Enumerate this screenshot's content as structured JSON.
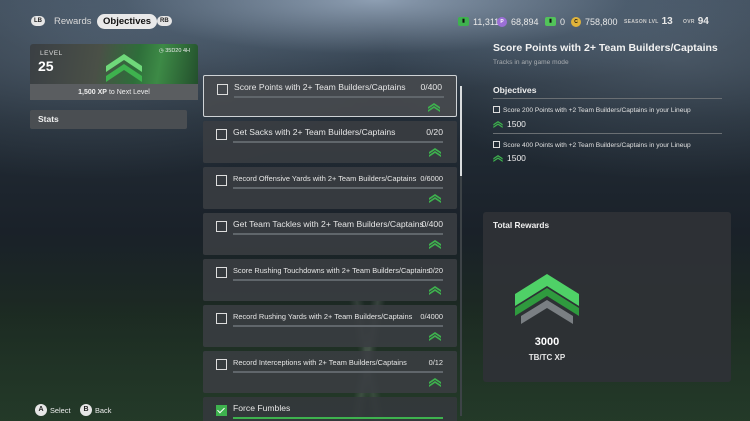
{
  "topbar": {
    "lb_hint": "LB",
    "rb_hint": "RB",
    "tabs": [
      {
        "label": "Rewards",
        "active": false
      },
      {
        "label": "Objectives",
        "active": true
      }
    ],
    "currencies": [
      {
        "icon": "training-icon",
        "value": "11,311",
        "color": "#3eb24e"
      },
      {
        "icon": "mut-points-icon",
        "value": "68,894",
        "color": "#9b6fd6"
      },
      {
        "icon": "tickets-icon",
        "value": "0",
        "color": "#52c45a"
      },
      {
        "icon": "coins-icon",
        "value": "758,800",
        "color": "#e0b33a"
      }
    ],
    "season_label": "SEASON LVL",
    "season_value": "13",
    "ovr_label": "OVR",
    "ovr_value": "94"
  },
  "level_card": {
    "label": "LEVEL",
    "level": "25",
    "time_left": "35D20 4H",
    "xp_amount": "1,500 XP",
    "xp_suffix": "to Next Level"
  },
  "stats_button": "Stats",
  "objectives": [
    {
      "title": "Score Points with 2+ Team Builders/Captains",
      "progress": "0/400",
      "small": false,
      "selected": true,
      "completed": false
    },
    {
      "title": "Get Sacks with 2+ Team Builders/Captains",
      "progress": "0/20",
      "small": false,
      "selected": false,
      "completed": false
    },
    {
      "title": "Record Offensive Yards with 2+ Team Builders/Captains",
      "progress": "0/6000",
      "small": true,
      "selected": false,
      "completed": false
    },
    {
      "title": "Get Team Tackles  with 2+ Team Builders/Captains",
      "progress": "0/400",
      "small": false,
      "selected": false,
      "completed": false
    },
    {
      "title": "Score Rushing Touchdowns  with 2+ Team Builders/Captains",
      "progress": "0/20",
      "small": true,
      "selected": false,
      "completed": false
    },
    {
      "title": "Record Rushing Yards with 2+ Team Builders/Captains",
      "progress": "0/4000",
      "small": true,
      "selected": false,
      "completed": false
    },
    {
      "title": "Record Interceptions with 2+ Team Builders/Captains",
      "progress": "0/12",
      "small": true,
      "selected": false,
      "completed": false
    },
    {
      "title": "Force Fumbles",
      "progress": "",
      "small": false,
      "selected": false,
      "completed": true
    }
  ],
  "detail": {
    "title": "Score Points with 2+ Team Builders/Captains",
    "subtitle": "Tracks in any game mode",
    "objectives_heading": "Objectives",
    "items": [
      {
        "text": "Score 200 Points with +2 Team Builders/Captains in your Lineup",
        "xp": "1500"
      },
      {
        "text": "Score 400 Points with +2 Team Builders/Captains in your Lineup",
        "xp": "1500"
      }
    ],
    "total_rewards_heading": "Total Rewards",
    "total_amount": "3000",
    "total_unit": "TB/TC XP"
  },
  "hints": [
    {
      "button": "A",
      "label": "Select"
    },
    {
      "button": "B",
      "label": "Back"
    }
  ]
}
